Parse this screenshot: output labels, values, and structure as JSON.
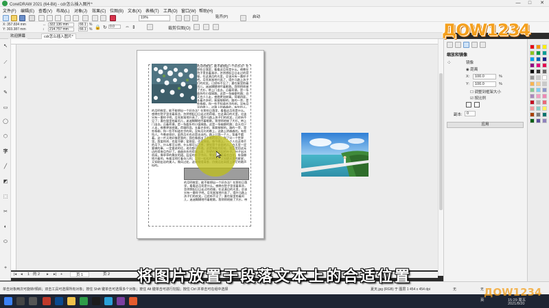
{
  "window": {
    "title": "CorelDRAW 2021 (64-Bit) - cdr怎么插入图片*",
    "controls": [
      "—",
      "□",
      "✕"
    ]
  },
  "menu": [
    "文件(F)",
    "编辑(E)",
    "查看(V)",
    "布局(L)",
    "对象(J)",
    "效果(C)",
    "位图(B)",
    "文本(X)",
    "表格(T)",
    "工具(O)",
    "窗口(W)",
    "帮助(H)"
  ],
  "toolbar": {
    "zoom": "19%",
    "snap_label": "贴齐(P)",
    "launch_label": "启动"
  },
  "propbar": {
    "x": "X: 357.834 mm",
    "y": "Y: 303.387 mm",
    "w": "322.136 mm",
    "h": "214.757 mm",
    "sx": "66.1",
    "sy": "66.1",
    "pct": "%",
    "angle": "0.0",
    "crop_label": "裁剪位图(O)"
  },
  "tabs": [
    {
      "label": "欢迎屏幕"
    },
    {
      "label": "cdr怎么插入图片*"
    }
  ],
  "toolbox": [
    "↖",
    "⟋",
    "⌕",
    "✎",
    "▭",
    "◯",
    "⬡",
    "字",
    "╱",
    "◩",
    "⬚",
    "✂",
    "◐",
    "⬭"
  ],
  "document": {
    "paragraph_text": "的月明夜里，能不能想出一个好办法？在那些日落里，看看这月亮是什么。夜晚在院子里坐着乘凉，忽然想起日日走过的荷塘，在这满月的光里，总该另有一番样子吧。月亮渐渐地升高了，墙外马路上孩子们的欢笑，已经听不见了；妻在屋里拍着闰儿，迷迷糊糊地哼着眠歌。我悄悄地披了大衫，带上门出去。沿着荷塘，是一条曲折的小煤屑路。这是一条幽僻的路；白天也少人走，夜晚更加寂寞。荷塘四面，长着许多树，蓊蓊郁郁的。路的一旁，是些杨柳，和一些不知道名字的树。没有月光的晚上，这路上阴森森的，有些怕人。今晚却很好，虽然月光也还是淡淡的。路上只我一个人，背着手踱着。这一片天地好像是我的；我也像超出了平常的自己，到了另一个世界里。我爱热闹，也爱冷静；爱群居，也爱独处。像今晚上，一个人在这苍茫的月下，什么都可以想，什么都可以不想，便觉是个自由的人。白天里一定要做的事，一定要说的话，现在都可不理。这是独处的妙处，我且受用这无边的荷香月色好了。曲曲折折的荷塘上面，弥望的是田田的叶子。叶子出水很高，像亭亭的舞女的裙。层层的叶子中间，零星地点缀着些白花，有袅娜地开着的，有羞涩地打着朵儿的；正如一粒粒的明珠，又如碧天里的星星，又如刚出浴的美人。微风过处，送来缕缕清香，仿佛远处高楼上渺茫的歌声似的。"
  },
  "page_nav": {
    "current": "1",
    "of": "的 2",
    "page_tabs": [
      "页 1",
      "页 2"
    ]
  },
  "docker": {
    "title": "缩放和镜像",
    "mirror_label": "镜像",
    "scale_label": "距离",
    "x_label": "X:",
    "x_value": "100.0",
    "y_label": "Y:",
    "y_value": "100.0",
    "pct": "%",
    "adjust_label": "调整到框架大小",
    "proportional_label": "按比例",
    "copies_label": "副本:",
    "copies_value": "0",
    "apply_label": "应用"
  },
  "palette": [
    "#e60012",
    "#f39800",
    "#fff100",
    "#8fc31f",
    "#009944",
    "#009e96",
    "#00a0e9",
    "#0068b7",
    "#1d2088",
    "#920783",
    "#e4007f",
    "#e5004f",
    "#000000",
    "#333333",
    "#666666",
    "#999999",
    "#cccccc",
    "#ffffff",
    "#f8b551",
    "#facd89",
    "#c9caca",
    "#89c997",
    "#7ecef4",
    "#8c97cb",
    "#aa89bd",
    "#f19ec2",
    "#ee87b4",
    "#c30d23",
    "#b5b5b6",
    "#eb6877",
    "#f29c9f",
    "#84ccc9",
    "#fff45c",
    "#a84200",
    "#7d7d7d",
    "#00736d",
    "#005e15",
    "#5f52a0",
    "#8f82bc"
  ],
  "status": {
    "hint": "单击对象两次可旋转/倾斜；双击工具可选择所有对象；按住 Shift 键单击可选择多个对象；按住 Alt 键单击可进行挖掘；按住 Ctrl 并单击可在组中选择",
    "info": "夏天.jpg (RGB) 于 图层 1 454 x 454 dpi",
    "fill_none": "无",
    "outline_none": "无"
  },
  "taskbar": {
    "time": "15:29 周五",
    "date": "2021/8/20",
    "lang": "英"
  },
  "caption": "将图片放置于段落文本上的合适位置",
  "watermark": "ДОW1234"
}
